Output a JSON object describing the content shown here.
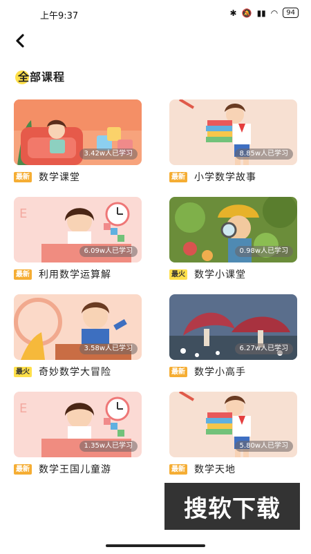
{
  "status_bar": {
    "time": "上午9:37",
    "battery": "94"
  },
  "section": {
    "title": "全部课程"
  },
  "courses": [
    {
      "title": "数学课堂",
      "badge": "最新",
      "learners": "3.42w人已学习"
    },
    {
      "title": "小学数学故事",
      "badge": "最新",
      "learners": "8.85w人已学习"
    },
    {
      "title": "利用数学运算解",
      "badge": "最新",
      "learners": "6.09w人已学习"
    },
    {
      "title": "数学小课堂",
      "badge": "最火",
      "learners": "0.98w人已学习"
    },
    {
      "title": "奇妙数学大冒险",
      "badge": "最火",
      "learners": "3.58w人已学习"
    },
    {
      "title": "数学小高手",
      "badge": "最新",
      "learners": "6.27w人已学习"
    },
    {
      "title": "数学王国儿童游",
      "badge": "最新",
      "learners": "1.35w人已学习"
    },
    {
      "title": "数学天地",
      "badge": "最新",
      "learners": "5.80w人已学习"
    }
  ],
  "watermark": {
    "text": "搜软下载"
  },
  "colors": {
    "badge_new": "#f5ad33",
    "badge_hot": "#ffe04a",
    "accent_dot": "#ffe04a"
  }
}
